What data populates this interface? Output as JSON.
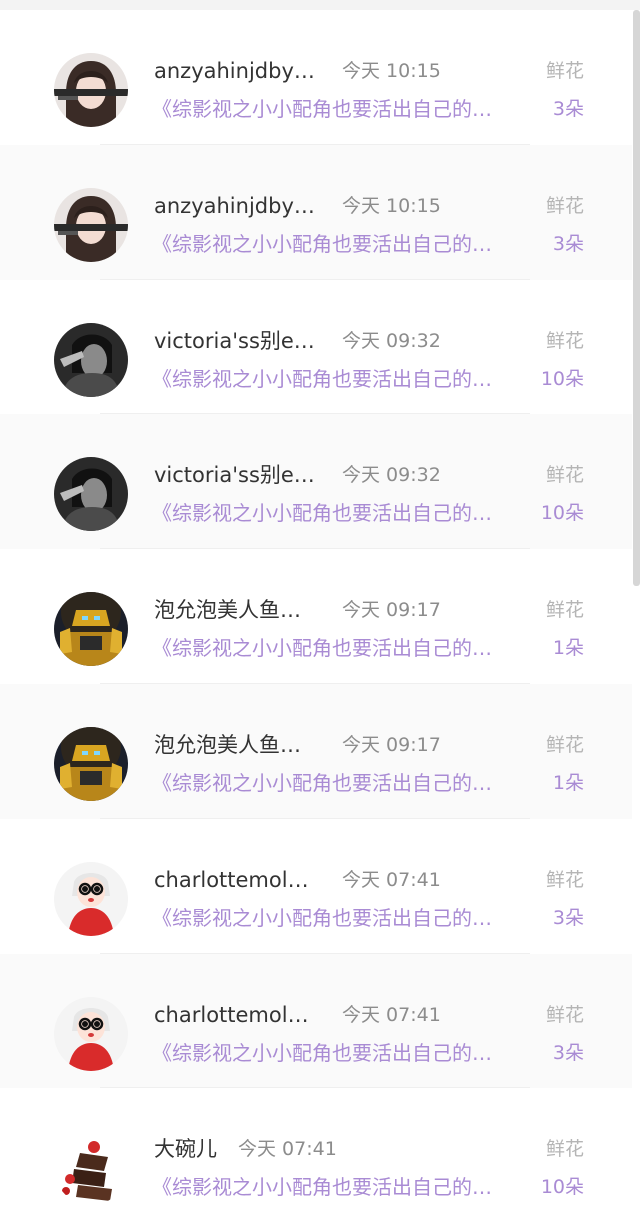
{
  "rows": [
    {
      "name": "anzyahinjdby…",
      "time": "今天 10:15",
      "gift_label": "鲜花",
      "book": "《综影视之小小配角也要活出自己的…",
      "count": "3朵",
      "avatar_icon": "girl-portrait-avatar-icon"
    },
    {
      "name": "anzyahinjdby…",
      "time": "今天 10:15",
      "gift_label": "鲜花",
      "book": "《综影视之小小配角也要活出自己的…",
      "count": "3朵",
      "avatar_icon": "girl-portrait-avatar-icon"
    },
    {
      "name": "victoria'ss别e…",
      "time": "今天 09:32",
      "gift_label": "鲜花",
      "book": "《综影视之小小配角也要活出自己的…",
      "count": "10朵",
      "avatar_icon": "monochrome-portrait-avatar-icon"
    },
    {
      "name": "victoria'ss别e…",
      "time": "今天 09:32",
      "gift_label": "鲜花",
      "book": "《综影视之小小配角也要活出自己的…",
      "count": "10朵",
      "avatar_icon": "monochrome-portrait-avatar-icon"
    },
    {
      "name": "泡允泡美人鱼…",
      "time": "今天 09:17",
      "gift_label": "鲜花",
      "book": "《综影视之小小配角也要活出自己的…",
      "count": "1朵",
      "avatar_icon": "robot-avatar-icon"
    },
    {
      "name": "泡允泡美人鱼…",
      "time": "今天 09:17",
      "gift_label": "鲜花",
      "book": "《综影视之小小配角也要活出自己的…",
      "count": "1朵",
      "avatar_icon": "robot-avatar-icon"
    },
    {
      "name": "charlottemol…",
      "time": "今天 07:41",
      "gift_label": "鲜花",
      "book": "《综影视之小小配角也要活出自己的…",
      "count": "3朵",
      "avatar_icon": "cartoon-girl-avatar-icon"
    },
    {
      "name": "charlottemol…",
      "time": "今天 07:41",
      "gift_label": "鲜花",
      "book": "《综影视之小小配角也要活出自己的…",
      "count": "3朵",
      "avatar_icon": "cartoon-girl-avatar-icon"
    },
    {
      "name": "大碗儿",
      "time": "今天 07:41",
      "gift_label": "鲜花",
      "book": "《综影视之小小配角也要活出自己的…",
      "count": "10朵",
      "avatar_icon": "chocolate-cake-avatar-icon"
    }
  ]
}
